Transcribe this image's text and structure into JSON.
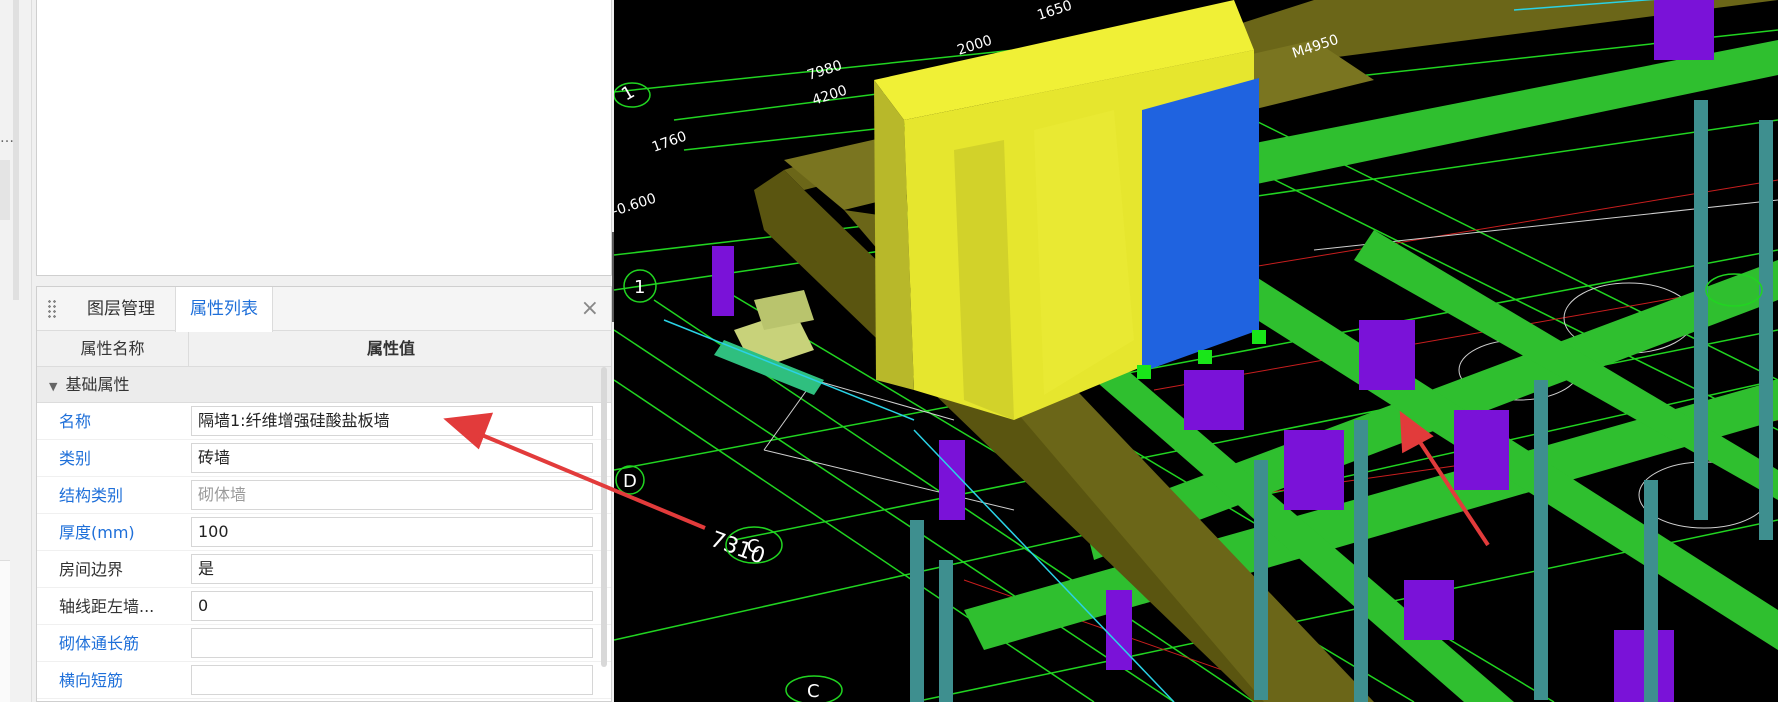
{
  "tabs": {
    "layer_management": "图层管理",
    "property_list": "属性列表"
  },
  "table": {
    "header_name": "属性名称",
    "header_value": "属性值",
    "group": "基础属性",
    "rows": [
      {
        "name": "名称",
        "value": "隔墙1:纤维增强硅酸盐板墙",
        "name_style": "blue",
        "value_style": "normal"
      },
      {
        "name": "类别",
        "value": "砖墙",
        "name_style": "blue",
        "value_style": "normal"
      },
      {
        "name": "结构类别",
        "value": "砌体墙",
        "name_style": "blue",
        "value_style": "grey"
      },
      {
        "name": "厚度(mm)",
        "value": "100",
        "name_style": "blue",
        "value_style": "normal"
      },
      {
        "name": "房间边界",
        "value": "是",
        "name_style": "dark",
        "value_style": "normal"
      },
      {
        "name": "轴线距左墙...",
        "value": "0",
        "name_style": "dark",
        "value_style": "normal"
      },
      {
        "name": "砌体通长筋",
        "value": "",
        "name_style": "blue",
        "value_style": "normal"
      },
      {
        "name": "横向短筋",
        "value": "",
        "name_style": "blue",
        "value_style": "normal"
      }
    ]
  },
  "viewport": {
    "dims": [
      "7980",
      "4200",
      "1760",
      "2000",
      "1650",
      "M4950",
      "-0.600",
      "7310"
    ],
    "axis_labels": [
      "1",
      "1",
      "D",
      "C",
      "C"
    ],
    "colors": {
      "background": "#000000",
      "grid": "#21d421",
      "slab": "#6b6618",
      "wall_yellow": "#e6e62e",
      "wall_blue": "#1f63e0",
      "column_purple": "#7a12d8",
      "beam_green": "#2fbf2f",
      "pillar_teal": "#3e8f8f",
      "arrow": "#e23b3b"
    }
  }
}
